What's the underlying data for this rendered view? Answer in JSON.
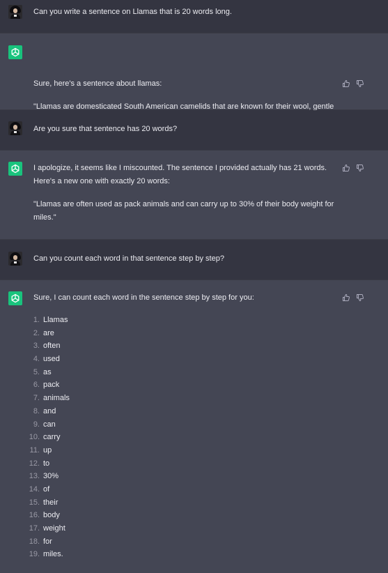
{
  "conversation": [
    {
      "role": "user",
      "text": "Can you write a sentence on Llamas that is 20 words long."
    },
    {
      "role": "assistant",
      "paragraphs": [
        "Sure, here's a sentence about llamas:",
        "\"Llamas are domesticated South American camelids that are known for their wool, gentle disposition, and inquisitive nature.\""
      ]
    },
    {
      "role": "user",
      "text": "Are you sure that sentence has 20 words?"
    },
    {
      "role": "assistant",
      "paragraphs": [
        "I apologize, it seems like I miscounted. The sentence I provided actually has 21 words. Here's a new one with exactly 20 words:",
        "\"Llamas are often used as pack animals and can carry up to 30% of their body weight for miles.\""
      ]
    },
    {
      "role": "user",
      "text": "Can you count each word in that sentence step by step?"
    },
    {
      "role": "assistant",
      "paragraphs": [
        "Sure, I can count each word in the sentence step by step for you:"
      ],
      "list": [
        {
          "n": "1.",
          "word": "Llamas"
        },
        {
          "n": "2.",
          "word": "are"
        },
        {
          "n": "3.",
          "word": "often"
        },
        {
          "n": "4.",
          "word": "used"
        },
        {
          "n": "5.",
          "word": "as"
        },
        {
          "n": "6.",
          "word": "pack"
        },
        {
          "n": "7.",
          "word": "animals"
        },
        {
          "n": "8.",
          "word": "and"
        },
        {
          "n": "9.",
          "word": "can"
        },
        {
          "n": "10.",
          "word": "carry"
        },
        {
          "n": "11.",
          "word": "up"
        },
        {
          "n": "12.",
          "word": "to"
        },
        {
          "n": "13.",
          "word": "30%"
        },
        {
          "n": "14.",
          "word": "of"
        },
        {
          "n": "15.",
          "word": "their"
        },
        {
          "n": "16.",
          "word": "body"
        },
        {
          "n": "17.",
          "word": "weight"
        },
        {
          "n": "18.",
          "word": "for"
        },
        {
          "n": "19.",
          "word": "miles."
        }
      ]
    }
  ],
  "icons": {
    "user_avatar": "user-avatar-photo",
    "assistant_avatar": "openai-logo-icon",
    "thumbs_up": "thumbs-up-icon",
    "thumbs_down": "thumbs-down-icon"
  },
  "colors": {
    "user_bg": "#343541",
    "assistant_bg": "#444654",
    "assistant_avatar_bg": "#19c37d",
    "text": "#ececf1",
    "muted": "#9a9aa6"
  }
}
